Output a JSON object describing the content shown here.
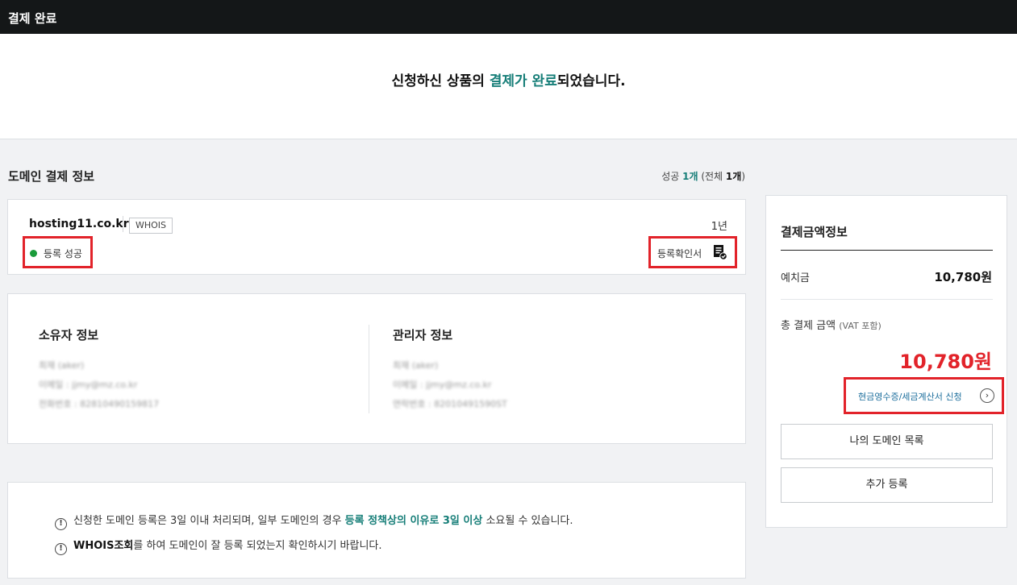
{
  "topbar": {
    "title": "결제 완료"
  },
  "hero": {
    "message_prefix": "신청하신 상품의 ",
    "message_highlight": "결제가 완료",
    "message_suffix": "되었습니다."
  },
  "section": {
    "title": "도메인 결제 정보",
    "summary_prefix": "성공 ",
    "summary_success": "1개",
    "summary_mid": " (전체 ",
    "summary_total": "1개",
    "summary_suffix": ")"
  },
  "domain": {
    "name": "hosting11.co.kr",
    "whois_label": "WHOIS",
    "period": "1년",
    "status": "등록 성공",
    "status_color": "#1a9b3a",
    "cert_label": "등록확인서"
  },
  "owner": {
    "title": "소유자 정보",
    "name_line": "최재 (aker)",
    "email_line": "이메일 : jjmy@mz.co.kr",
    "phone_line": "전화번호 : 82810490159817"
  },
  "admin": {
    "title": "관리자 정보",
    "name_line": "최재 (aker)",
    "email_line": "이메일 : jjmy@mz.co.kr",
    "phone_line": "연락번호 : 82010491590ST"
  },
  "notice": {
    "row1_text": "신청한 도메인 등록은 3일 이내 처리되며, 일부 도메인의 경우 ",
    "row1_highlight": "등록 정책상의 이유로 3일 이상",
    "row1_suffix": " 소요될 수 있습니다.",
    "row2_bold": "WHOIS조회",
    "row2_text": "를 하여 도메인이 잘 등록 되었는지 확인하시기 바랍니다."
  },
  "payment": {
    "title": "결제금액정보",
    "deposit_label": "예치금",
    "deposit_value": "10,780원",
    "total_label": "총 결제 금액",
    "vat_label": "(VAT 포함)",
    "total_value": "10,780원",
    "receipt_link": "현금영수증/세금계산서 신청",
    "my_domains_button": "나의 도메인 목록",
    "add_register_button": "추가 등록",
    "accent_color": "#e2232a",
    "brand_color": "#167e78"
  }
}
